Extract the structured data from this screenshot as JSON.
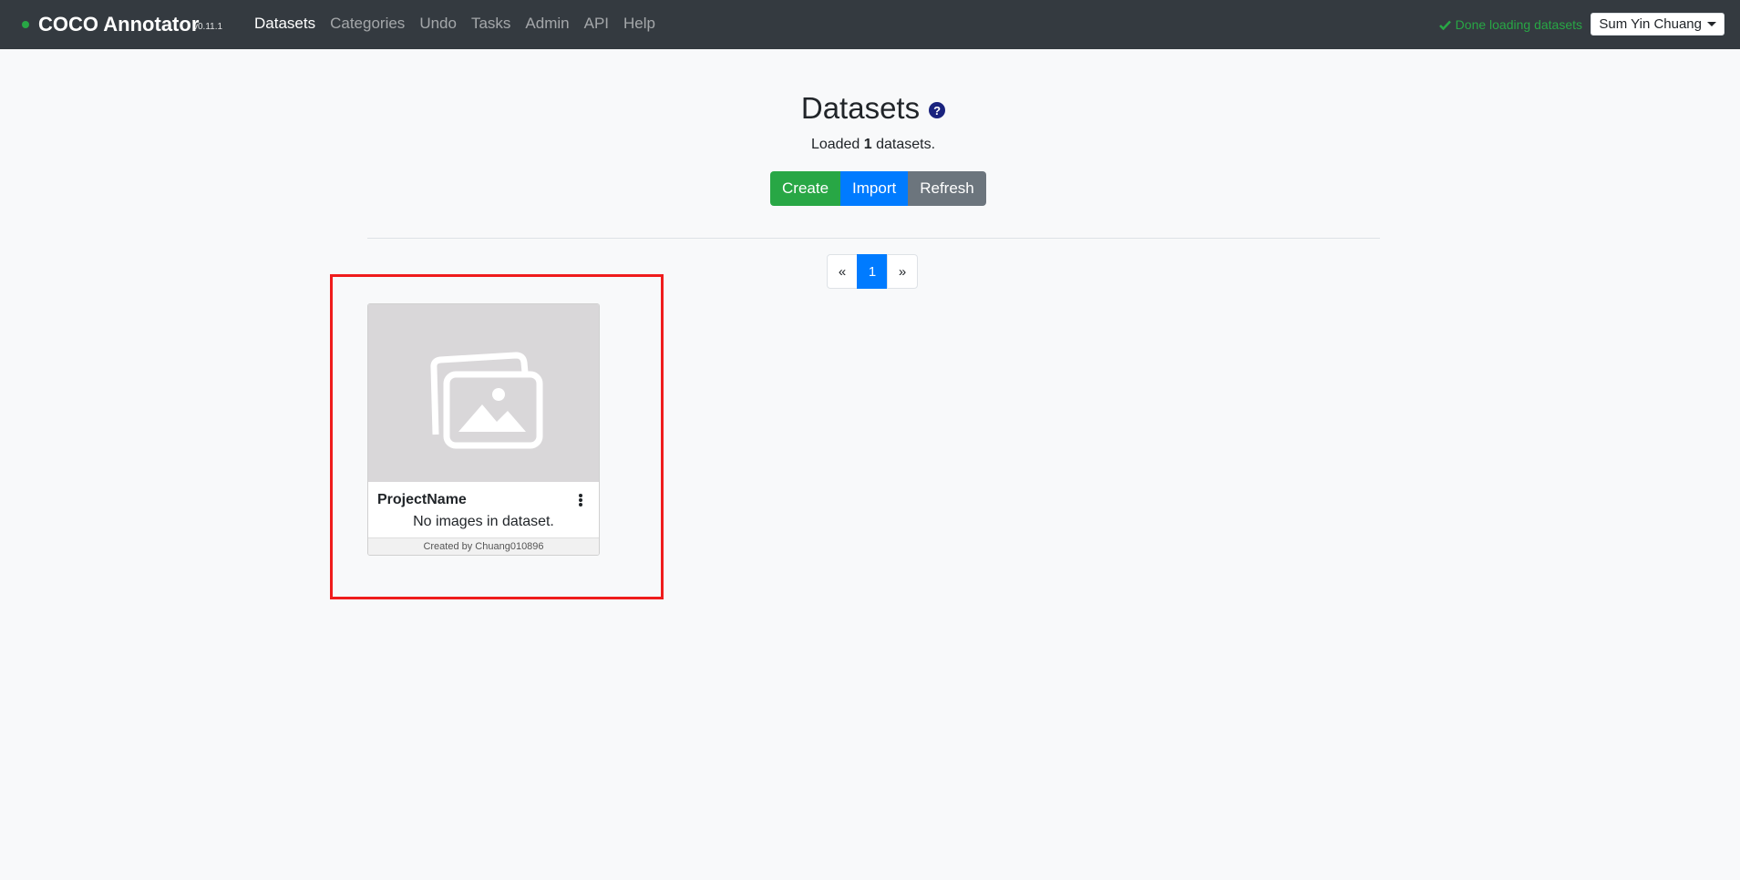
{
  "navbar": {
    "brand": "COCO Annotator",
    "version": "v0.11.1",
    "links": [
      "Datasets",
      "Categories",
      "Undo",
      "Tasks",
      "Admin",
      "API",
      "Help"
    ],
    "status": "Done loading datasets",
    "user": "Sum Yin Chuang"
  },
  "page": {
    "title": "Datasets",
    "subtitle_prefix": "Loaded ",
    "subtitle_count": "1",
    "subtitle_suffix": " datasets.",
    "buttons": {
      "create": "Create",
      "import": "Import",
      "refresh": "Refresh"
    }
  },
  "pagination": {
    "prev": "«",
    "current": "1",
    "next": "»"
  },
  "dataset_card": {
    "name": "ProjectName",
    "body": "No images in dataset.",
    "footer": "Created by Chuang010896"
  },
  "colors": {
    "navbar": "#343a40",
    "success": "#28a745",
    "primary": "#007bff",
    "secondary": "#6c757d",
    "highlight": "#ef1c1c"
  }
}
